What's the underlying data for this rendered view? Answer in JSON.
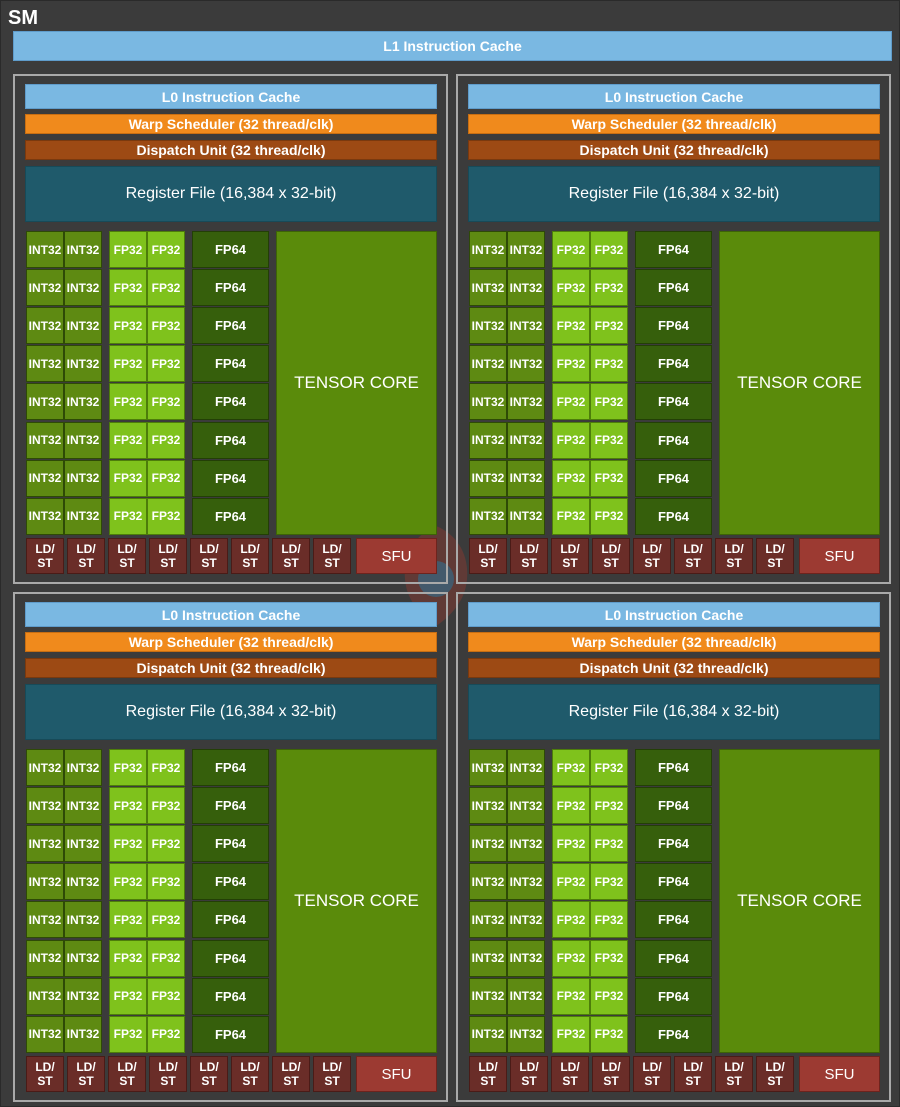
{
  "sm": {
    "title": "SM",
    "l1_cache": "L1 Instruction Cache"
  },
  "partition": {
    "l0_cache": "L0 Instruction Cache",
    "warp_scheduler": "Warp Scheduler (32 thread/clk)",
    "dispatch_unit": "Dispatch Unit (32 thread/clk)",
    "register_file": "Register File (16,384 x 32-bit)",
    "int32_label": "INT32",
    "fp32_label": "FP32",
    "fp64_label": "FP64",
    "tensor_core_label": "TENSOR CORE",
    "ldst_line1": "LD/",
    "ldst_line2": "ST",
    "sfu_label": "SFU"
  },
  "layout_counts": {
    "partitions": 4,
    "rows_per_partition": 8,
    "int32_per_row": 2,
    "fp32_per_row": 2,
    "fp64_per_row": 1,
    "ldst_units": 8,
    "sfu_units": 1,
    "tensor_cores": 1
  },
  "colors": {
    "background": "#3b3b3b",
    "cache": "#7ab8e2",
    "warp_scheduler": "#f08a1c",
    "dispatch_unit": "#9d4a14",
    "register_file": "#1f5a6b",
    "int32": "#5e8a12",
    "fp32": "#7fc21c",
    "fp64": "#365f0c",
    "tensor_core": "#5a8b0b",
    "ldst": "#6a2d28",
    "sfu": "#9c3a32"
  }
}
